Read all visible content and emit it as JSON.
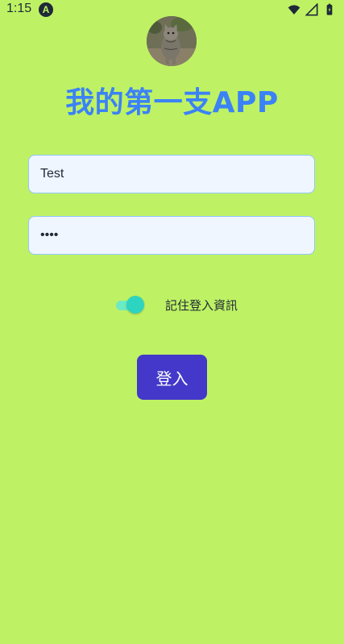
{
  "status_bar": {
    "time": "1:15",
    "notification_icon": "a-notification-icon",
    "icons": [
      "wifi-icon",
      "signal-icon",
      "battery-icon"
    ]
  },
  "avatar": {
    "icon": "cat-photo"
  },
  "title": "我的第一支APP",
  "username": {
    "value": "Test"
  },
  "password": {
    "value": "••••"
  },
  "remember": {
    "label": "記住登入資訊",
    "enabled": true
  },
  "login_button": {
    "label": "登入"
  },
  "colors": {
    "background": "#bef264",
    "title": "#3b82f6",
    "button": "#4338ca",
    "switch": "#2dd4bf",
    "field_bg": "#eff6ff",
    "field_border": "#93c5fd"
  }
}
